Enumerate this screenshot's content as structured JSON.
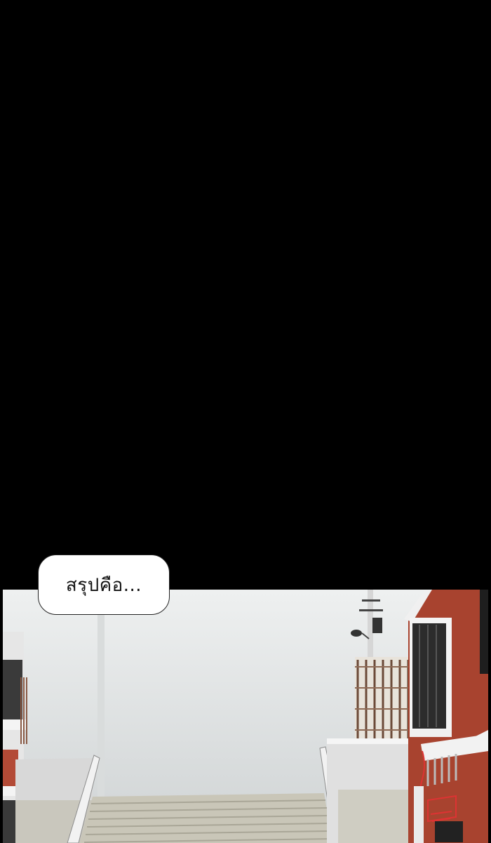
{
  "panel": {
    "speech_bubble_text": "สรุปคือ..."
  },
  "colors": {
    "background": "#000000",
    "sky_top": "#eef0f0",
    "sky_bottom": "#cfd3d4",
    "brick": "#a8432f",
    "rail_white": "#f2f2f2"
  }
}
